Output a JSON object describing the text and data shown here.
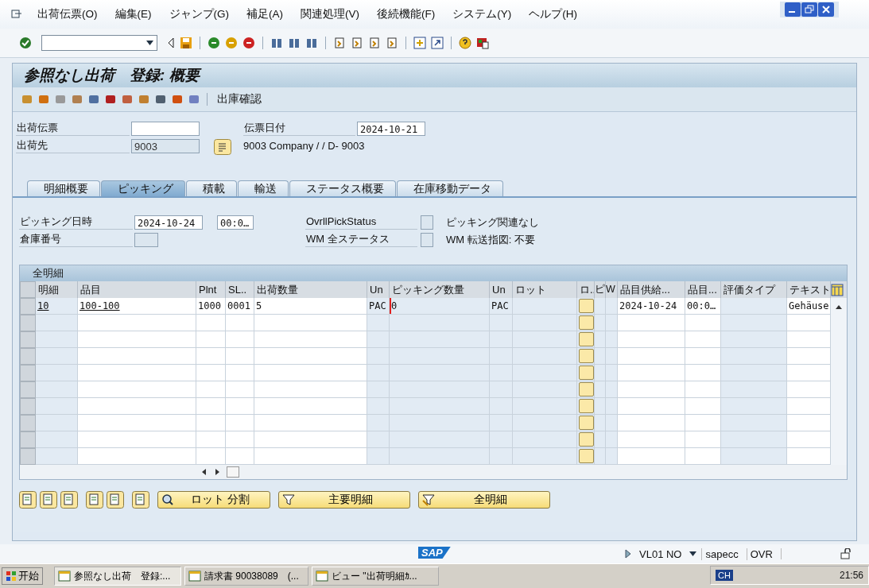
{
  "menu": [
    "出荷伝票(O)",
    "編集(E)",
    "ジャンプ(G)",
    "補足(A)",
    "関連処理(V)",
    "後続機能(F)",
    "システム(Y)",
    "ヘルプ(H)"
  ],
  "title": "参照なし出荷　登録: 概要",
  "app_toolbar": {
    "label": "出庫確認"
  },
  "header": {
    "fields": [
      {
        "label": "出荷伝票",
        "kind": "input"
      },
      {
        "label": "出荷先",
        "value": "9003",
        "kind": "display"
      }
    ],
    "date": {
      "label": "伝票日付",
      "value": "2024-10-21"
    },
    "shipto_text": "9003 Company / / D- 9003"
  },
  "tabs": [
    {
      "label": "明細概要",
      "selected": false
    },
    {
      "label": "ピッキング",
      "selected": true
    },
    {
      "label": "積載",
      "selected": false
    },
    {
      "label": "輸送",
      "selected": false
    },
    {
      "label": "ステータス概要",
      "selected": false
    },
    {
      "label": "在庫移動データ",
      "selected": false
    }
  ],
  "picking": {
    "date_label": "ピッキング日時",
    "date": "2024-10-24",
    "time": "00:0…",
    "warehouse_label": "倉庫番号",
    "status": [
      {
        "label": "OvrllPickStatus",
        "text": "ピッキング関連なし"
      },
      {
        "label": "WM 全ステータス",
        "text": "WM 転送指図: 不要"
      }
    ]
  },
  "table": {
    "title": "全明細",
    "columns": [
      {
        "label": "明細",
        "kind": "link"
      },
      {
        "label": "品目",
        "kind": "link"
      },
      {
        "label": "Plnt",
        "kind": "text"
      },
      {
        "label": "SL..",
        "kind": "text"
      },
      {
        "label": "出荷数量",
        "kind": "text"
      },
      {
        "label": "Un",
        "kind": "text"
      },
      {
        "label": "ピッキング数量",
        "kind": "input"
      },
      {
        "label": "Un",
        "kind": "text"
      },
      {
        "label": "ロット",
        "kind": "text"
      },
      {
        "label": "ロ..",
        "kind": "button"
      },
      {
        "label": "ピ",
        "kind": "text"
      },
      {
        "label": "W",
        "kind": "text"
      },
      {
        "label": "品目供給...",
        "kind": "text"
      },
      {
        "label": "品目...",
        "kind": "text"
      },
      {
        "label": "評価タイプ",
        "kind": "text"
      },
      {
        "label": "テキスト",
        "kind": "text"
      }
    ],
    "rows": [
      {
        "cells": [
          "10",
          "100-100",
          "1000",
          "0001",
          "5",
          "PAC",
          "0",
          "PAC",
          null,
          null,
          null,
          null,
          "2024-10-24",
          "00:0…",
          null,
          "Gehäuse"
        ]
      }
    ]
  },
  "buttons": [
    {
      "label": "ロット 分割"
    },
    {
      "label": "主要明細"
    },
    {
      "label": "全明細"
    }
  ],
  "status_bar": {
    "logo": "SAP",
    "transaction": "VL01 NO",
    "server": "sapecc",
    "mode": "OVR"
  },
  "taskbar": {
    "start": "开始",
    "tasks": [
      "参照なし出荷　登録:...",
      "請求書 90038089　(...",
      "ビュー \"出荷明細ｶ..."
    ],
    "lang": "CH",
    "clock": "21:56"
  }
}
